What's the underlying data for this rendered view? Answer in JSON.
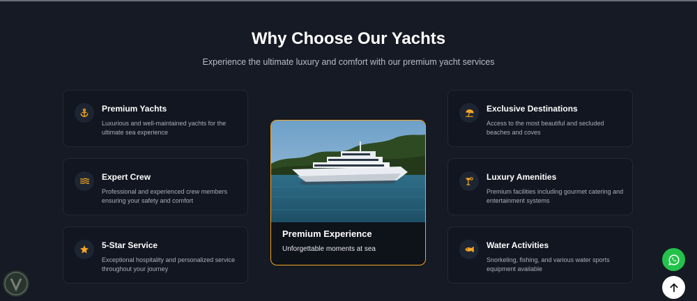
{
  "section": {
    "title": "Why Choose Our Yachts",
    "subtitle": "Experience the ultimate luxury and comfort with our premium yacht services"
  },
  "features_left": [
    {
      "title": "Premium Yachts",
      "description": "Luxurious and well-maintained yachts for the ultimate sea experience",
      "icon": "anchor-icon"
    },
    {
      "title": "Expert Crew",
      "description": "Professional and experienced crew members ensuring your safety and comfort",
      "icon": "waves-icon"
    },
    {
      "title": "5-Star Service",
      "description": "Exceptional hospitality and personalized service throughout your journey",
      "icon": "star-icon"
    }
  ],
  "features_right": [
    {
      "title": "Exclusive Destinations",
      "description": "Access to the most beautiful and secluded beaches and coves",
      "icon": "umbrella-beach-icon"
    },
    {
      "title": "Luxury Amenities",
      "description": "Premium facilities including gourmet catering and entertainment systems",
      "icon": "cocktail-icon"
    },
    {
      "title": "Water Activities",
      "description": "Snorkeling, fishing, and various water sports equipment available",
      "icon": "fish-icon"
    }
  ],
  "highlight": {
    "title": "Premium Experience",
    "subtitle": "Unforgettable moments at sea"
  },
  "colors": {
    "background": "#151a24",
    "card": "#111620",
    "accent": "#f5a623",
    "whatsapp": "#25c24b"
  }
}
